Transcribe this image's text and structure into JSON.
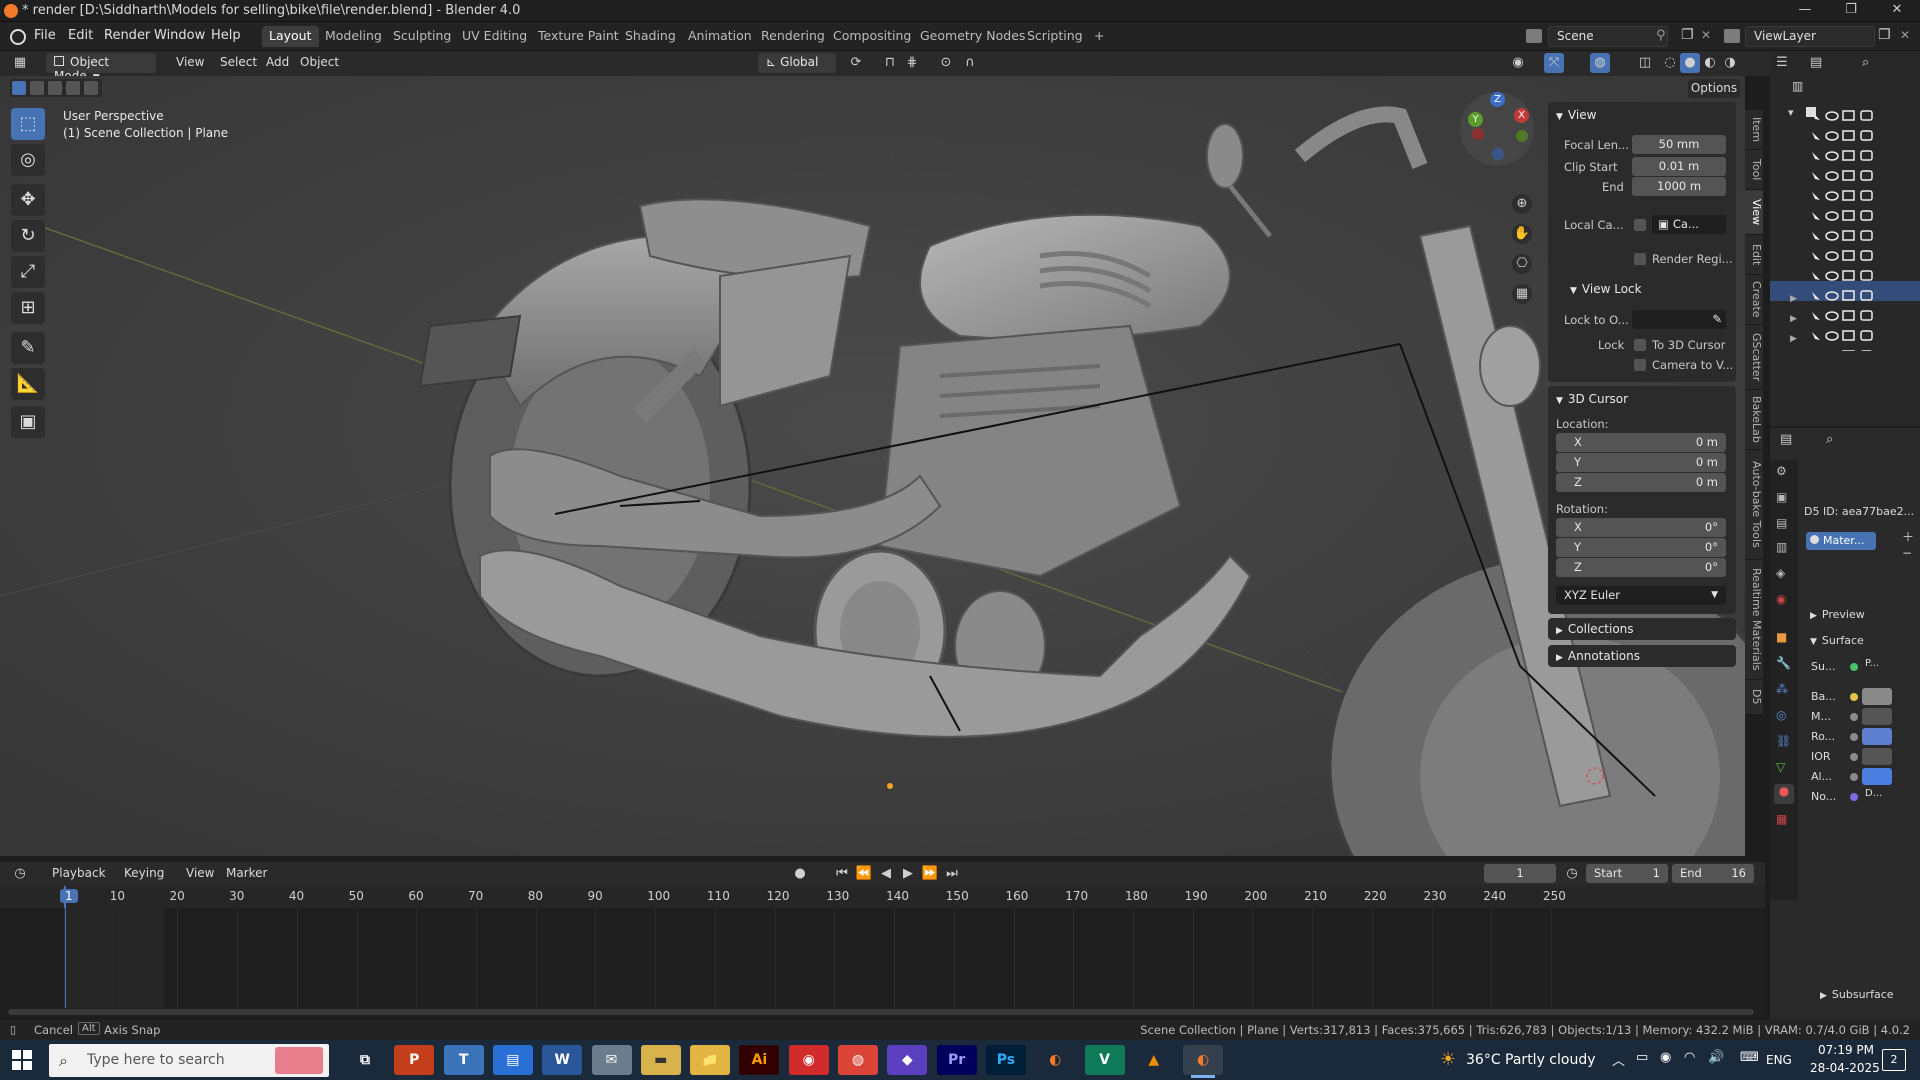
{
  "window": {
    "title": "* render [D:\\Siddharth\\Models for selling\\bike\\file\\render.blend] - Blender 4.0",
    "minimize": "—",
    "maximize": "❐",
    "close": "✕"
  },
  "menu": [
    "File",
    "Edit",
    "Render",
    "Window",
    "Help"
  ],
  "workspaces": {
    "tabs": [
      "Layout",
      "Modeling",
      "Sculpting",
      "UV Editing",
      "Texture Paint",
      "Shading",
      "Animation",
      "Rendering",
      "Compositing",
      "Geometry Nodes",
      "Scripting"
    ],
    "active": "Layout",
    "add": "+"
  },
  "scene_selector": {
    "scene": "Scene",
    "view_layer": "ViewLayer"
  },
  "viewport_header": {
    "mode": "Object Mode",
    "menus": [
      "View",
      "Select",
      "Add",
      "Object"
    ],
    "orientation": "Global",
    "options_label": "Options"
  },
  "viewport": {
    "info_line1": "User Perspective",
    "info_line2": "(1) Scene Collection | Plane",
    "gizmo": {
      "x": "X",
      "y": "Y",
      "z": "Z"
    }
  },
  "side_tabs": [
    "Item",
    "Tool",
    "View",
    "Edit",
    "Create",
    "GScatter",
    "BakeLab",
    "Auto-bake Tools",
    "Realtime Materials",
    "D5"
  ],
  "side_tab_active": "View",
  "npanel": {
    "view": {
      "title": "View",
      "focal_label": "Focal Len...",
      "focal_value": "50 mm",
      "clip_start_label": "Clip Start",
      "clip_start_value": "0.01 m",
      "end_label": "End",
      "end_value": "1000 m",
      "local_cam_label": "Local Ca...",
      "local_cam_value": "Ca...",
      "render_region": "Render Regi..."
    },
    "view_lock": {
      "title": "View Lock",
      "lock_to_label": "Lock to O...",
      "lock_label": "Lock",
      "to_cursor": "To 3D Cursor",
      "camera_to_view": "Camera to V..."
    },
    "cursor": {
      "title": "3D Cursor",
      "location_label": "Location:",
      "loc": [
        {
          "axis": "X",
          "value": "0 m"
        },
        {
          "axis": "Y",
          "value": "0 m"
        },
        {
          "axis": "Z",
          "value": "0 m"
        }
      ],
      "rotation_label": "Rotation:",
      "rot": [
        {
          "axis": "X",
          "value": "0°"
        },
        {
          "axis": "Y",
          "value": "0°"
        },
        {
          "axis": "Z",
          "value": "0°"
        }
      ],
      "mode": "XYZ Euler"
    },
    "collections": "Collections",
    "annotations": "Annotations"
  },
  "properties": {
    "d5_id": "D5 ID: aea77bae2...",
    "material": "Mater...",
    "preview": "Preview",
    "surface": "Surface",
    "rows": [
      {
        "label": "Su...",
        "value": "P..."
      },
      {
        "label": "Ba...",
        "value": ""
      },
      {
        "label": "M...",
        "value": ""
      },
      {
        "label": "Ro...",
        "value": ""
      },
      {
        "label": "IOR",
        "value": ""
      },
      {
        "label": "Al...",
        "value": ""
      },
      {
        "label": "No...",
        "value": "D..."
      }
    ],
    "subsurface": "Subsurface"
  },
  "timeline": {
    "menus": [
      "Playback",
      "Keying",
      "View",
      "Marker"
    ],
    "current_frame": "1",
    "start_label": "Start",
    "start_value": "1",
    "end_label": "End",
    "end_value": "16",
    "ruler": [
      "1",
      "10",
      "20",
      "30",
      "40",
      "50",
      "60",
      "70",
      "80",
      "90",
      "100",
      "110",
      "120",
      "130",
      "140",
      "150",
      "160",
      "170",
      "180",
      "190",
      "200",
      "210",
      "220",
      "230",
      "240",
      "250"
    ]
  },
  "status": {
    "cancel": "Cancel",
    "alt": "Alt",
    "axis_snap": "Axis Snap",
    "stats": "Scene Collection | Plane | Verts:317,813 | Faces:375,665 | Tris:626,783 | Objects:1/13 | Memory: 432.2 MiB | VRAM: 0.7/4.0 GiB | 4.0.2"
  },
  "taskbar": {
    "search_placeholder": "Type here to search",
    "weather": "36°C  Partly cloudy",
    "lang": "ENG",
    "time": "07:19 PM",
    "date": "28-04-2025",
    "notif": "2",
    "apps": [
      {
        "name": "task-view",
        "label": "⧉",
        "bg": "#1b2a3a",
        "fg": "#ffffff"
      },
      {
        "name": "powerpoint",
        "label": "P",
        "bg": "#c43e1c",
        "fg": "#ffffff"
      },
      {
        "name": "teams",
        "label": "T",
        "bg": "#3a73b8",
        "fg": "#ffffff"
      },
      {
        "name": "explorer-blue",
        "label": "▤",
        "bg": "#2a6fd6",
        "fg": "#ffffff"
      },
      {
        "name": "word",
        "label": "W",
        "bg": "#2b579a",
        "fg": "#ffffff"
      },
      {
        "name": "mail",
        "label": "✉",
        "bg": "#6b7c8c",
        "fg": "#ffffff"
      },
      {
        "name": "sticky",
        "label": "▬",
        "bg": "#d8b24a",
        "fg": "#333333"
      },
      {
        "name": "file-explorer",
        "label": "📁",
        "bg": "#e1b53f",
        "fg": "#333333"
      },
      {
        "name": "illustrator",
        "label": "Ai",
        "bg": "#330000",
        "fg": "#ff9a00"
      },
      {
        "name": "app-red",
        "label": "◉",
        "bg": "#d12b2b",
        "fg": "#ffffff"
      },
      {
        "name": "chrome",
        "label": "◍",
        "bg": "#db4437",
        "fg": "#ffffff"
      },
      {
        "name": "m365",
        "label": "◆",
        "bg": "#5a3fbf",
        "fg": "#ffffff"
      },
      {
        "name": "premiere",
        "label": "Pr",
        "bg": "#00005b",
        "fg": "#9999ff"
      },
      {
        "name": "photoshop",
        "label": "Ps",
        "bg": "#001e36",
        "fg": "#31a8ff"
      },
      {
        "name": "blender-2",
        "label": "◐",
        "bg": "#1b2a3a",
        "fg": "#f5792a"
      },
      {
        "name": "vectorworks",
        "label": "V",
        "bg": "#0f7a58",
        "fg": "#ffffff"
      },
      {
        "name": "vlc",
        "label": "▲",
        "bg": "#1b2a3a",
        "fg": "#f08c00"
      },
      {
        "name": "blender",
        "label": "◐",
        "bg": "#34404d",
        "fg": "#f5792a"
      }
    ]
  },
  "colors": {
    "accent": "#4772b3",
    "grid_x": "#8b3d3d",
    "grid_y": "#6a8b3a",
    "frame_cursor": "#4772b3"
  }
}
